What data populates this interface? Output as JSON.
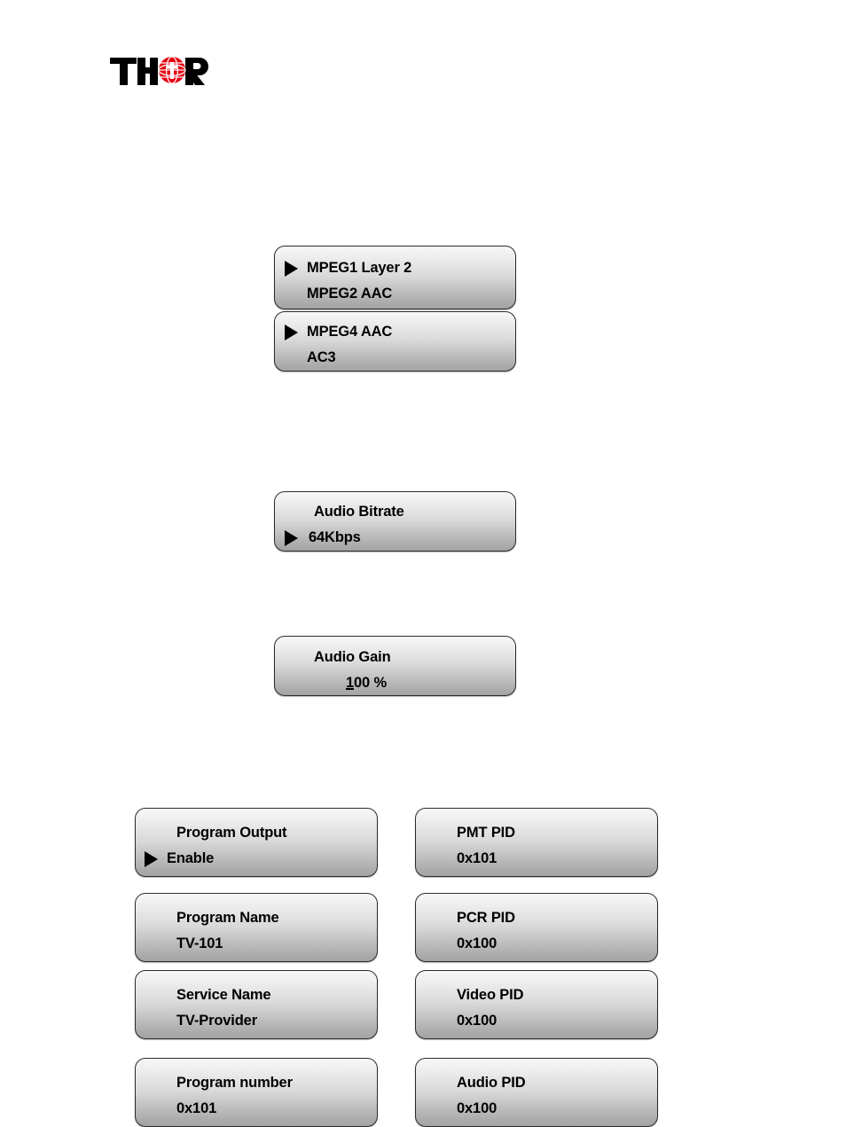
{
  "brand": {
    "logo_text": "THOR",
    "logo_icon": "globe-icon",
    "logo_color": "#e60012"
  },
  "audio_codec_menu": {
    "name": "audio-codec-menu",
    "screens": [
      {
        "line1": "MPEG1 Layer 2",
        "line1_marker": "selection-arrow",
        "line2": "MPEG2 AAC",
        "line2_marker": "none"
      },
      {
        "line1": "MPEG4 AAC",
        "line1_marker": "selection-arrow",
        "line2": "AC3",
        "line2_marker": "none"
      }
    ]
  },
  "audio_bitrate": {
    "label": "Audio Bitrate",
    "value": "64Kbps",
    "marker": "selection-arrow"
  },
  "audio_gain": {
    "label": "Audio Gain",
    "value_cursor_char": "1",
    "value_rest": "00 %",
    "value_full": "100 %"
  },
  "program_params": {
    "left_column": [
      {
        "label": "Program Output",
        "value": "Enable",
        "marker": "selection-arrow"
      },
      {
        "label": "Program Name",
        "value": "TV-101",
        "marker": "none"
      },
      {
        "label": "Service Name",
        "value": "TV-Provider",
        "marker": "none"
      },
      {
        "label": "Program number",
        "value": "0x101",
        "marker": "none"
      }
    ],
    "right_column": [
      {
        "label": "PMT PID",
        "value": "0x101",
        "marker": "none"
      },
      {
        "label": "PCR PID",
        "value": "0x100",
        "marker": "none"
      },
      {
        "label": "Video PID",
        "value": "0x100",
        "marker": "none"
      },
      {
        "label": "Audio PID",
        "value": "0x100",
        "marker": "none"
      }
    ]
  }
}
